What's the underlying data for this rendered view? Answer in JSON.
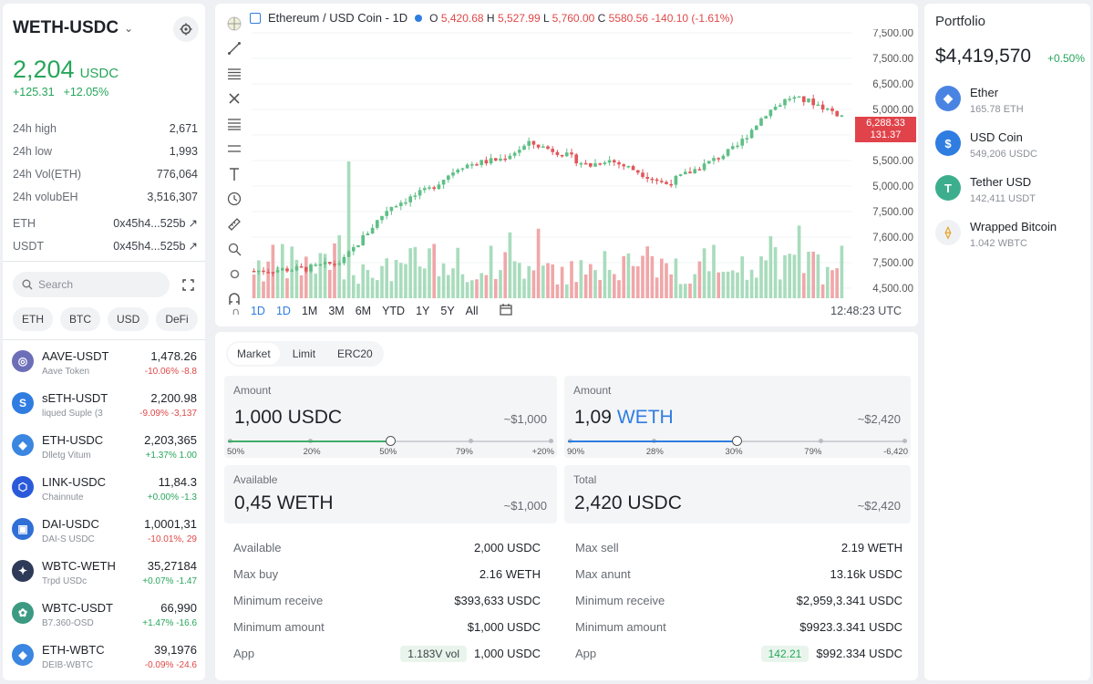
{
  "pair": {
    "name": "WETH-USDC",
    "price": "2,204",
    "price_unit": "USDC",
    "change_abs": "+125.31",
    "change_pct": "+12.05%"
  },
  "stats": [
    {
      "label": "24h high",
      "value": "2,671"
    },
    {
      "label": "24h low",
      "value": "1,993"
    },
    {
      "label": "24h Vol(ETH)",
      "value": "776,064"
    },
    {
      "label": "24h volubEH",
      "value": "3,516,307"
    }
  ],
  "addresses": [
    {
      "label": "ETH",
      "value": "0x45h4...525b"
    },
    {
      "label": "USDT",
      "value": "0x45h4...525b"
    }
  ],
  "search": {
    "placeholder": "Search"
  },
  "filters": [
    "ETH",
    "BTC",
    "USD",
    "DeFi"
  ],
  "markets": [
    {
      "name": "AAVE-USDT",
      "sub": "Aave Token",
      "price": "1,478.26",
      "change": "-10.06% -8.8",
      "dir": "down",
      "icon": "aave-icon",
      "color": "#6c6fb8",
      "glyph": "◎"
    },
    {
      "name": "sETH-USDT",
      "sub": "liqued Suple (3",
      "price": "2,200.98",
      "change": "-9.09% -3,137",
      "dir": "down",
      "icon": "seth-icon",
      "color": "#2f7de1",
      "glyph": "S"
    },
    {
      "name": "ETH-USDC",
      "sub": "Dlletg Vitum",
      "price": "2,203,365",
      "change": "+1.37% 1.00",
      "dir": "up",
      "icon": "eth-icon",
      "color": "#3a86e0",
      "glyph": "◆"
    },
    {
      "name": "LINK-USDC",
      "sub": "Chainnute",
      "price": "11,84.3",
      "change": "+0.00% -1.3",
      "dir": "up",
      "icon": "link-icon",
      "color": "#2a5ada",
      "glyph": "⬡"
    },
    {
      "name": "DAI-USDC",
      "sub": "DAI-S USDC",
      "price": "1,0001,31",
      "change": "-10.01%, 29",
      "dir": "down",
      "icon": "dai-icon",
      "color": "#2f6fd6",
      "glyph": "▣"
    },
    {
      "name": "WBTC-WETH",
      "sub": "Trpd USDc",
      "price": "35,27184",
      "change": "+0.07% -1.47",
      "dir": "up",
      "icon": "wbtc-icon",
      "color": "#2d3a58",
      "glyph": "✦"
    },
    {
      "name": "WBTC-USDT",
      "sub": "B7.360-OSD",
      "price": "66,990",
      "change": "+1.47% -16.6",
      "dir": "up",
      "icon": "wbtc-usdt-icon",
      "color": "#3c9a82",
      "glyph": "✿"
    },
    {
      "name": "ETH-WBTC",
      "sub": "DEIB-WBTC",
      "price": "39,1976",
      "change": "-0.09% -24.6",
      "dir": "down",
      "icon": "eth-wbtc-icon",
      "color": "#3a86e0",
      "glyph": "◆"
    }
  ],
  "chart": {
    "title": "Ethereum / USD Coin - 1D",
    "ohlc": {
      "o": "5,420.68",
      "h": "5,527.99",
      "l": "5,760.00",
      "c": "5580.56",
      "change": "-140.10 (-1.61%)"
    },
    "y_labels": [
      "7,500.00",
      "7,500.00",
      "6,500.00",
      "5,000.00",
      "5,600.00",
      "5,500.00",
      "5,000.00",
      "7,500.00",
      "7,600.00",
      "7,500.00",
      "4,500.00"
    ],
    "price_tag": [
      "6,288.33",
      "131.37"
    ],
    "timeframes": [
      "1D",
      "1D",
      "1M",
      "3M",
      "6M",
      "YTD",
      "1Y",
      "5Y",
      "All"
    ],
    "time": "12:48:23 UTC",
    "colors": {
      "up": "#5fbf86",
      "down": "#e0565a",
      "vol_up": "#a8dcbc",
      "vol_down": "#f0a7a9"
    }
  },
  "chart_data": {
    "type": "candlestick",
    "series": [
      {
        "name": "Ethereum / USD Coin - 1D"
      }
    ]
  },
  "order": {
    "tabs": [
      "Market",
      "Limit",
      "ERC20"
    ],
    "pay": {
      "label": "Amount",
      "amount": "1,000",
      "currency": "USDC",
      "usd": "~$1,000",
      "ticks": [
        "50%",
        "20%",
        "50%",
        "79%",
        "+20%"
      ],
      "level": 0.5,
      "color": "#3fae68"
    },
    "receive": {
      "label": "Amount",
      "amount": "1,09",
      "currency": "WETH",
      "usd": "~$2,420",
      "ticks": [
        "90%",
        "28%",
        "30%",
        "79%",
        "-6,420"
      ],
      "level": 0.5,
      "color": "#2f7de1"
    },
    "available": {
      "label": "Available",
      "amount": "0,45 WETH",
      "usd": "~$1,000"
    },
    "total": {
      "label": "Total",
      "amount": "2,420 USDC",
      "usd": "~$2,420"
    },
    "left_rows": [
      {
        "k": "Available",
        "v": "2,000 USDC"
      },
      {
        "k": "Max buy",
        "v": "2.16 WETH"
      },
      {
        "k": "Minimum receive",
        "v": "$393,633 USDC"
      },
      {
        "k": "Minimum amount",
        "v": "$1,000 USDC"
      },
      {
        "k": "App",
        "pill": "1.183V vol",
        "v": "1,000 USDC"
      }
    ],
    "right_rows": [
      {
        "k": "Max sell",
        "v": "2.19 WETH"
      },
      {
        "k": "Max anunt",
        "v": "13.16k USDC"
      },
      {
        "k": "Minimum receive",
        "v": "$2,959,3.341 USDC"
      },
      {
        "k": "Minimum amount",
        "v": "$9923.3.341 USDC"
      },
      {
        "k": "App",
        "pill": "142.21",
        "v": "$992.334 USDC"
      }
    ]
  },
  "portfolio": {
    "title": "Portfolio",
    "value": "$4,419,570",
    "change": "+0.50%",
    "assets": [
      {
        "name": "Ether",
        "qty": "165.78 ETH",
        "color": "#4a84e3",
        "glyph": "◆",
        "icon": "ether-icon"
      },
      {
        "name": "USD Coin",
        "qty": "549,206 USDC",
        "color": "#2f7de1",
        "glyph": "$",
        "icon": "usd-coin-icon"
      },
      {
        "name": "Tether USD",
        "qty": "142,411 USDT",
        "color": "#3cae8e",
        "glyph": "T",
        "icon": "tether-icon"
      },
      {
        "name": "Wrapped Bitcoin",
        "qty": "1.042 WBTC",
        "color": "#f0f1f4",
        "glyph": "⟠",
        "icon": "wbtc-icon"
      }
    ]
  }
}
